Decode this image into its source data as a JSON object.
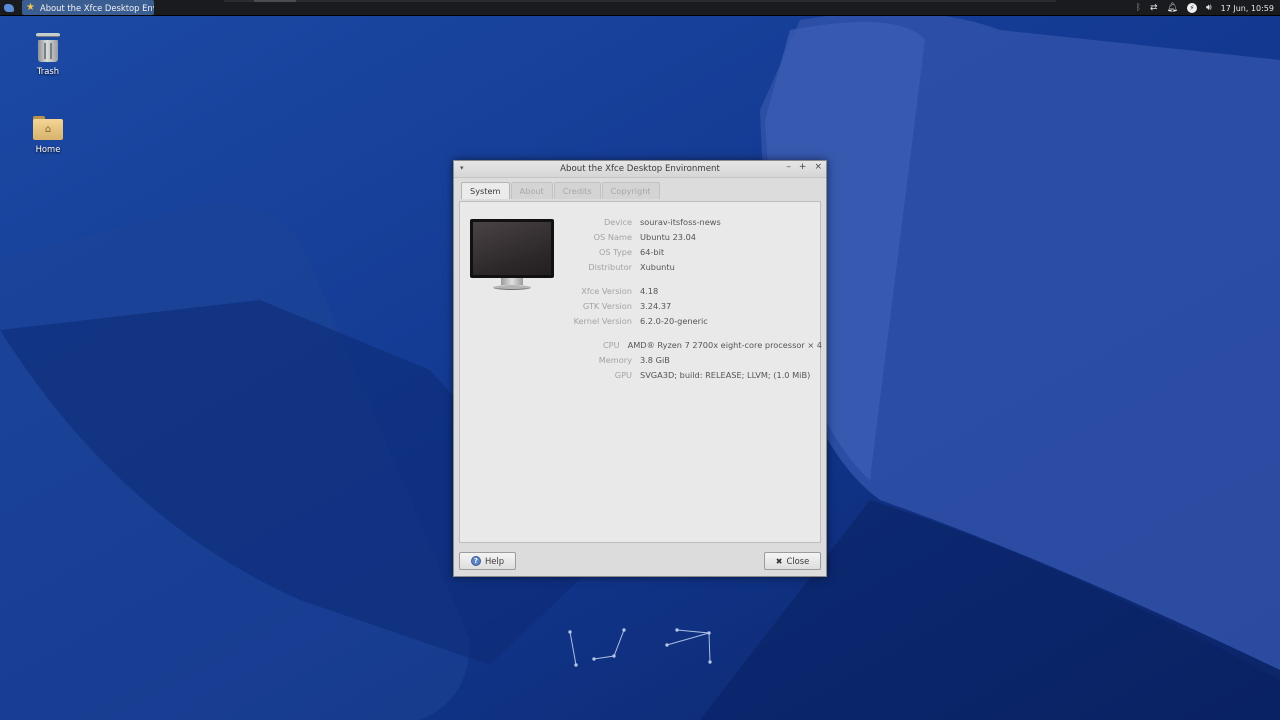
{
  "panel": {
    "taskbar_item": "About the Xfce Desktop Envi...",
    "clock": "17 Jun, 10:59"
  },
  "desktop": {
    "icons": [
      {
        "label": "Trash"
      },
      {
        "label": "Home"
      }
    ]
  },
  "window": {
    "title": "About the Xfce Desktop Environment",
    "tabs": [
      {
        "label": "System",
        "active": true
      },
      {
        "label": "About",
        "active": false
      },
      {
        "label": "Credits",
        "active": false
      },
      {
        "label": "Copyright",
        "active": false
      }
    ],
    "system_info": [
      {
        "key": "Device",
        "value": "sourav-itsfoss-news"
      },
      {
        "key": "OS Name",
        "value": "Ubuntu 23.04"
      },
      {
        "key": "OS Type",
        "value": "64-bit"
      },
      {
        "key": "Distributor",
        "value": "Xubuntu"
      },
      {
        "key": "Xfce Version",
        "value": "4.18"
      },
      {
        "key": "GTK Version",
        "value": "3.24.37"
      },
      {
        "key": "Kernel Version",
        "value": "6.2.0-20-generic"
      },
      {
        "key": "CPU",
        "value": "AMD® Ryzen 7 2700x eight-core processor × 4"
      },
      {
        "key": "Memory",
        "value": "3.8 GiB"
      },
      {
        "key": "GPU",
        "value": "SVGA3D; build: RELEASE; LLVM; (1.0 MiB)"
      }
    ],
    "help_label": "Help",
    "close_label": "Close"
  },
  "colors": {
    "wallpaper_dark": "#0f2a73",
    "wallpaper_light": "#2a54b0",
    "panel": "#1a1b1e",
    "taskbar_active": "#3a5d92"
  }
}
